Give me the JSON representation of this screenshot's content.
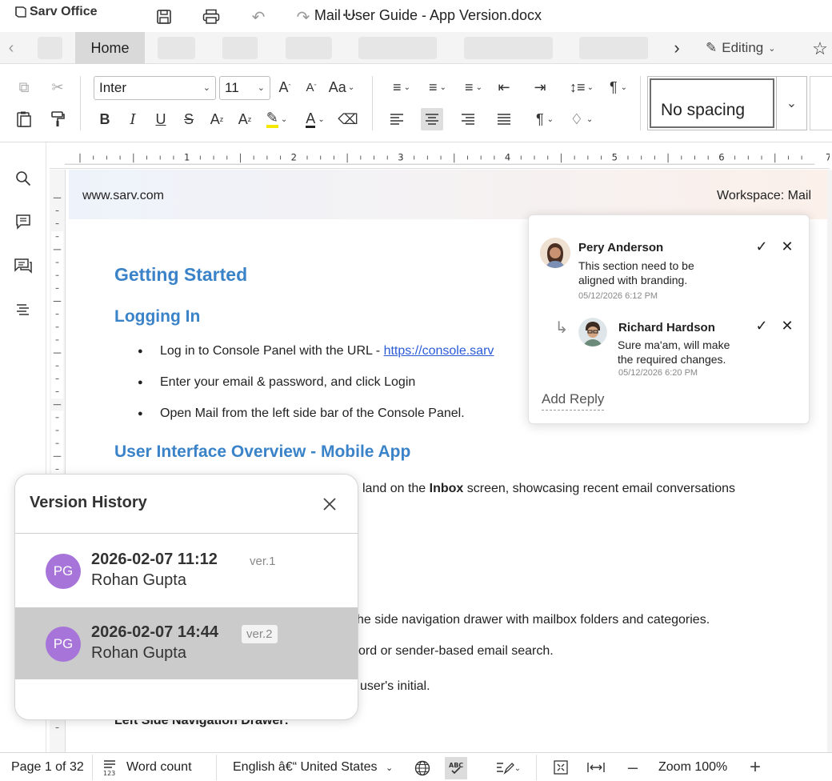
{
  "app": {
    "name": "Sarv Office",
    "doc_title": "Mail User Guide - App Version.docx"
  },
  "tabs": {
    "home": "Home",
    "editing": "Editing"
  },
  "toolbar": {
    "font": "Inter",
    "size": "11",
    "style": "No spacing"
  },
  "ruler": {
    "marks": [
      "1",
      "2",
      "3",
      "4",
      "5",
      "6",
      "7"
    ]
  },
  "document": {
    "header_left": "www.sarv.com",
    "header_right": "Workspace: Mail",
    "h_getting_started": "Getting Started",
    "h_logging_in": "Logging In",
    "bullet1_prefix": "Log in to Console Panel with the URL - ",
    "bullet1_link": "https://console.sarv",
    "bullet2": "Enter your email & password, and click Login",
    "bullet3": "Open Mail from the left side bar of the Console Panel.",
    "h_ui_overview": "User Interface Overview - Mobile App",
    "para1_prefix": "land on the ",
    "para1_bold": "Inbox",
    "para1_suffix": " screen, showcasing recent email conversations",
    "para2": "he side navigation drawer with mailbox folders and categories.",
    "para3": "ord or sender-based email search.",
    "para4": "user's initial.",
    "para5": "Left Side Navigation Drawer:"
  },
  "comments": [
    {
      "name": "Pery Anderson",
      "text_line1": "This section need to be",
      "text_line2": "aligned with branding.",
      "date": "05/12/2026 6:12 PM"
    },
    {
      "name": "Richard Hardson",
      "text_line1": "Sure ma'am, will make",
      "text_line2": "the required changes.",
      "date": "05/12/2026 6:20 PM"
    }
  ],
  "comment_actions": {
    "add_reply": "Add Reply"
  },
  "version_history": {
    "title": "Version History",
    "versions": [
      {
        "initials": "PG",
        "datetime": "2026-02-07 11:12",
        "name": "Rohan Gupta",
        "ver": "ver.1"
      },
      {
        "initials": "PG",
        "datetime": "2026-02-07 14:44",
        "name": "Rohan Gupta",
        "ver": "ver.2"
      }
    ]
  },
  "status": {
    "page": "Page 1 of 32",
    "word_count": "Word count",
    "language": "English â€“ United States",
    "zoom": "Zoom 100%"
  }
}
